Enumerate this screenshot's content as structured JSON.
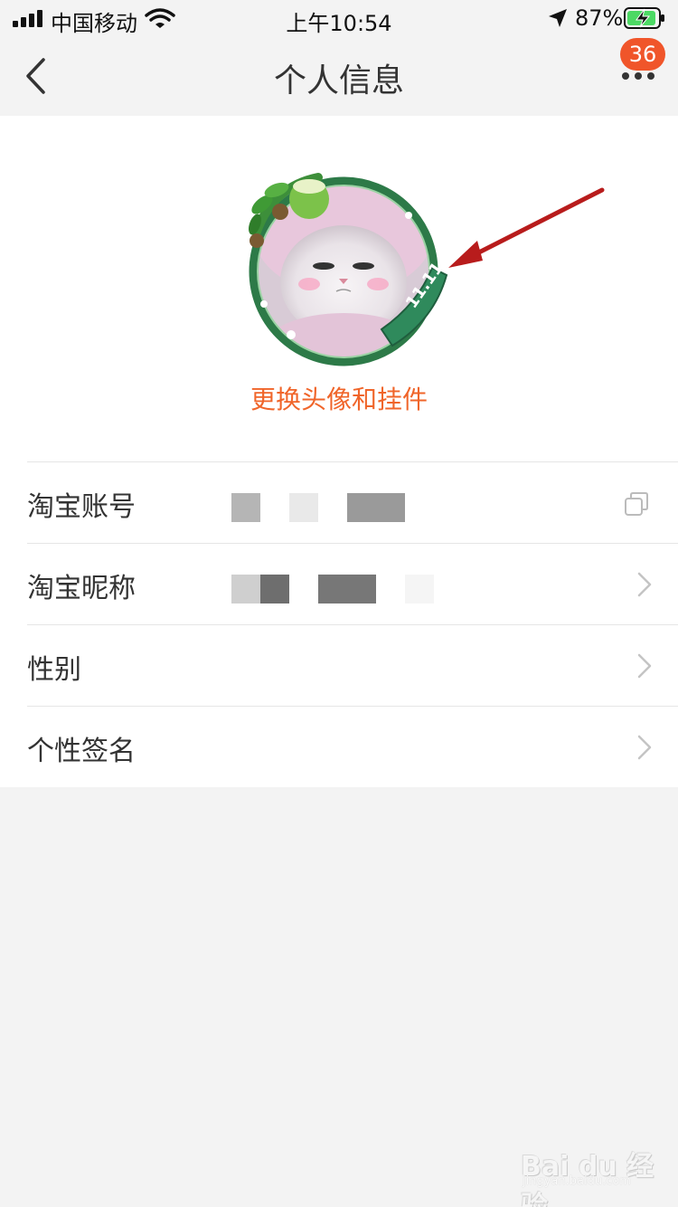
{
  "status_bar": {
    "carrier": "中国移动",
    "time": "上午10:54",
    "battery_percent": "87%"
  },
  "nav": {
    "title": "个人信息",
    "badge_count": "36"
  },
  "avatar": {
    "change_label": "更换头像和挂件"
  },
  "rows": [
    {
      "label": "淘宝账号",
      "trailing": "copy-icon"
    },
    {
      "label": "淘宝昵称",
      "trailing": "chevron-right-icon"
    },
    {
      "label": "性别",
      "trailing": "chevron-right-icon"
    },
    {
      "label": "个性签名",
      "trailing": "chevron-right-icon"
    }
  ],
  "watermark": {
    "main": "Bai du 经验",
    "sub": "jingyan.baidu.com"
  },
  "colors": {
    "accent": "#f0652a",
    "badge": "#f0552a",
    "background": "#f3f3f3",
    "annotation_arrow": "#b81c1c"
  }
}
